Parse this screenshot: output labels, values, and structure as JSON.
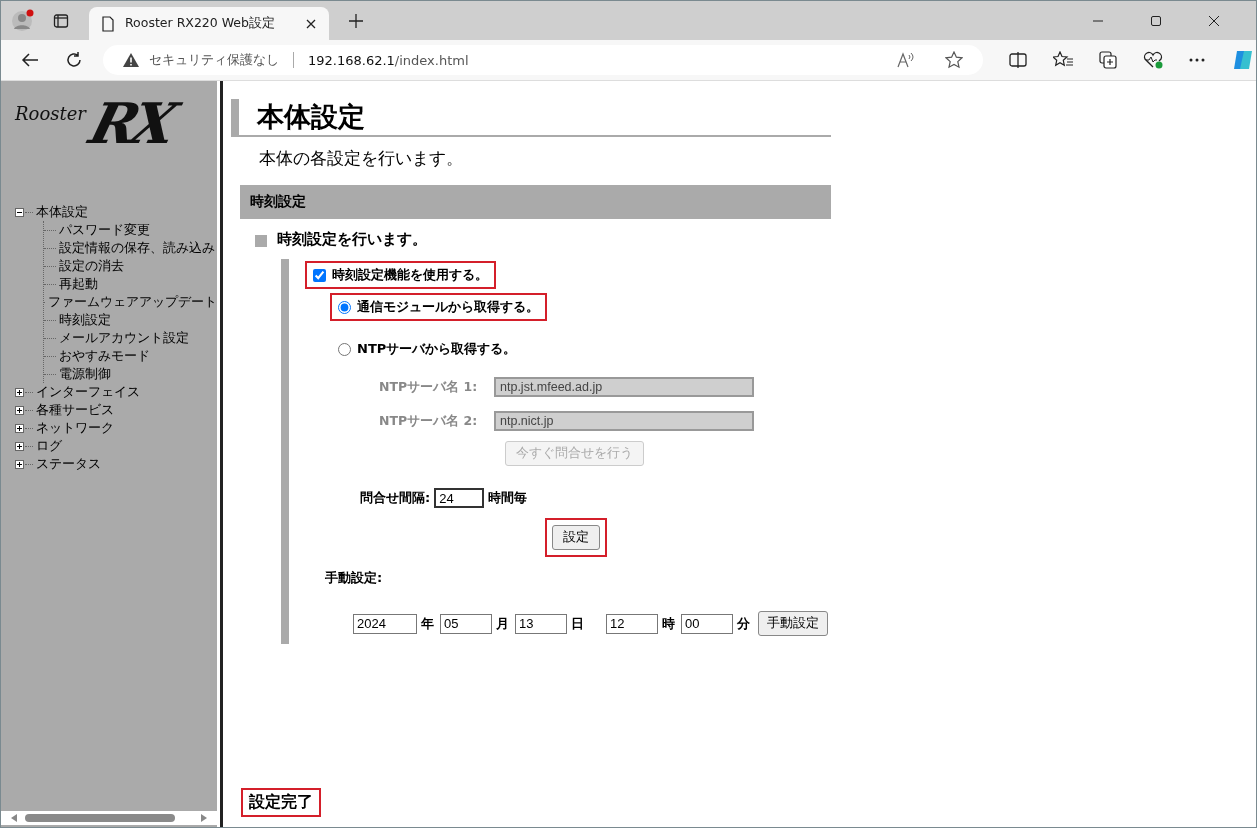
{
  "browser": {
    "tab_title": "Rooster RX220 Web設定",
    "security_label": "セキュリティ保護なし",
    "url_host": "192.168.62.1",
    "url_path": "/index.html"
  },
  "logo": {
    "script_text": "Rooster",
    "mark_text": "RX"
  },
  "nav": [
    {
      "label": "本体設定",
      "expanded": true,
      "children": [
        {
          "label": "パスワード変更"
        },
        {
          "label": "設定情報の保存、読み込み"
        },
        {
          "label": "設定の消去"
        },
        {
          "label": "再起動"
        },
        {
          "label": "ファームウェアアップデート"
        },
        {
          "label": "時刻設定"
        },
        {
          "label": "メールアカウント設定"
        },
        {
          "label": "おやすみモード"
        },
        {
          "label": "電源制御"
        }
      ]
    },
    {
      "label": "インターフェイス",
      "expanded": false
    },
    {
      "label": "各種サービス",
      "expanded": false
    },
    {
      "label": "ネットワーク",
      "expanded": false
    },
    {
      "label": "ログ",
      "expanded": false
    },
    {
      "label": "ステータス",
      "expanded": false
    }
  ],
  "page": {
    "title": "本体設定",
    "subtitle": "本体の各設定を行います。",
    "section_title": "時刻設定",
    "section_note": "時刻設定を行います。",
    "enable": {
      "label": "時刻設定機能を使用する。",
      "checked": true,
      "highlighted": true
    },
    "sources": [
      {
        "label": "通信モジュールから取得する。",
        "selected": true,
        "highlighted": true
      },
      {
        "label": "NTPサーバから取得する。",
        "selected": false,
        "highlighted": false
      }
    ],
    "ntp_servers": [
      {
        "label": "NTPサーバ名 1:",
        "value": "ntp.jst.mfeed.ad.jp",
        "disabled": true
      },
      {
        "label": "NTPサーバ名 2:",
        "value": "ntp.nict.jp",
        "disabled": true
      }
    ],
    "query_now_button": {
      "label": "今すぐ問合せを行う",
      "disabled": true
    },
    "interval": {
      "label": "問合せ間隔:",
      "value": "24",
      "unit": "時間毎"
    },
    "set_button": {
      "label": "設定",
      "highlighted": true
    },
    "manual": {
      "label": "手動設定:",
      "button": "手動設定",
      "fields": [
        {
          "value": "2024",
          "unit": "年"
        },
        {
          "value": "05",
          "unit": "月"
        },
        {
          "value": "13",
          "unit": "日"
        },
        {
          "value": "12",
          "unit": "時"
        },
        {
          "value": "00",
          "unit": "分"
        }
      ]
    },
    "status": {
      "text": "設定完了",
      "highlighted": true
    }
  }
}
